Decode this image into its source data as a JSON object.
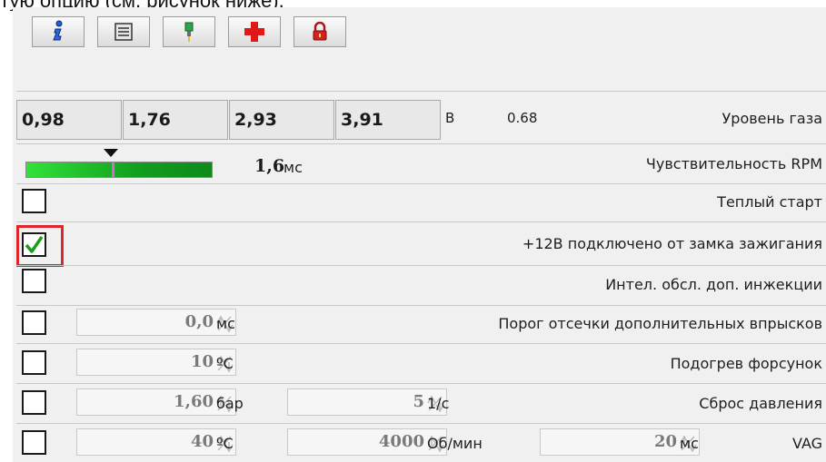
{
  "heading_text": "тую опцию (см. рисунок ниже).",
  "toolbar": {
    "buttons": [
      {
        "icon": "info-icon"
      },
      {
        "icon": "list-icon"
      },
      {
        "icon": "injector-icon"
      },
      {
        "icon": "red-cross-icon"
      },
      {
        "icon": "lock-icon"
      }
    ]
  },
  "gas_level": {
    "values": [
      "0,98",
      "1,76",
      "2,93",
      "3,91"
    ],
    "unit": "В",
    "reading": "0.68",
    "label": "Уровень газа"
  },
  "rpm_sensitivity": {
    "value": "1,6",
    "unit": "мс",
    "label": "Чувствительность RPM",
    "slider_fraction": 0.46
  },
  "options": [
    {
      "label": "Теплый старт",
      "checked": false
    },
    {
      "label": "+12В подключено от замка зажигания",
      "checked": true
    },
    {
      "label": "Интел. обсл. доп. инжекции",
      "checked": false
    }
  ],
  "threshold": {
    "value": "0,0",
    "unit": "мс",
    "label": "Порог отсечки дополнительных впрысков",
    "checked": false
  },
  "heating": {
    "value": "10",
    "unit": "ºС",
    "label": "Подогрев форсунок",
    "checked": false
  },
  "pressure_reset": {
    "value1": "1,60",
    "unit1": "бар",
    "value2": "5",
    "unit2": "1/с",
    "label": "Сброс давления",
    "checked": false
  },
  "vag": {
    "value1": "40",
    "unit1": "ºС",
    "value2": "4000",
    "unit2": "Об/мин",
    "value3": "20",
    "unit3": "мс",
    "label": "VAG",
    "checked": false
  },
  "colors": {
    "highlight": "#e0242b",
    "check": "#1a9e1a",
    "slider": "#19b724"
  }
}
